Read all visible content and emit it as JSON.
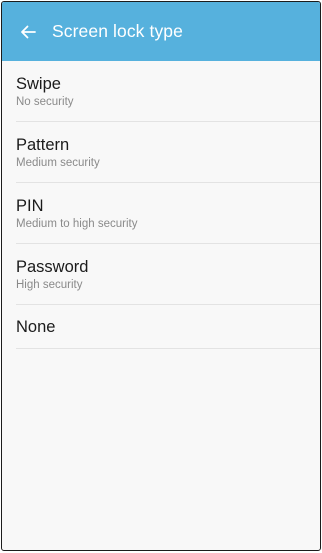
{
  "app_bar": {
    "title": "Screen lock type",
    "back_icon": "arrow-left-icon",
    "color": "#56b1dd"
  },
  "options": [
    {
      "title": "Swipe",
      "subtitle": "No security"
    },
    {
      "title": "Pattern",
      "subtitle": "Medium security"
    },
    {
      "title": "PIN",
      "subtitle": "Medium to high security"
    },
    {
      "title": "Password",
      "subtitle": "High security"
    },
    {
      "title": "None"
    }
  ]
}
